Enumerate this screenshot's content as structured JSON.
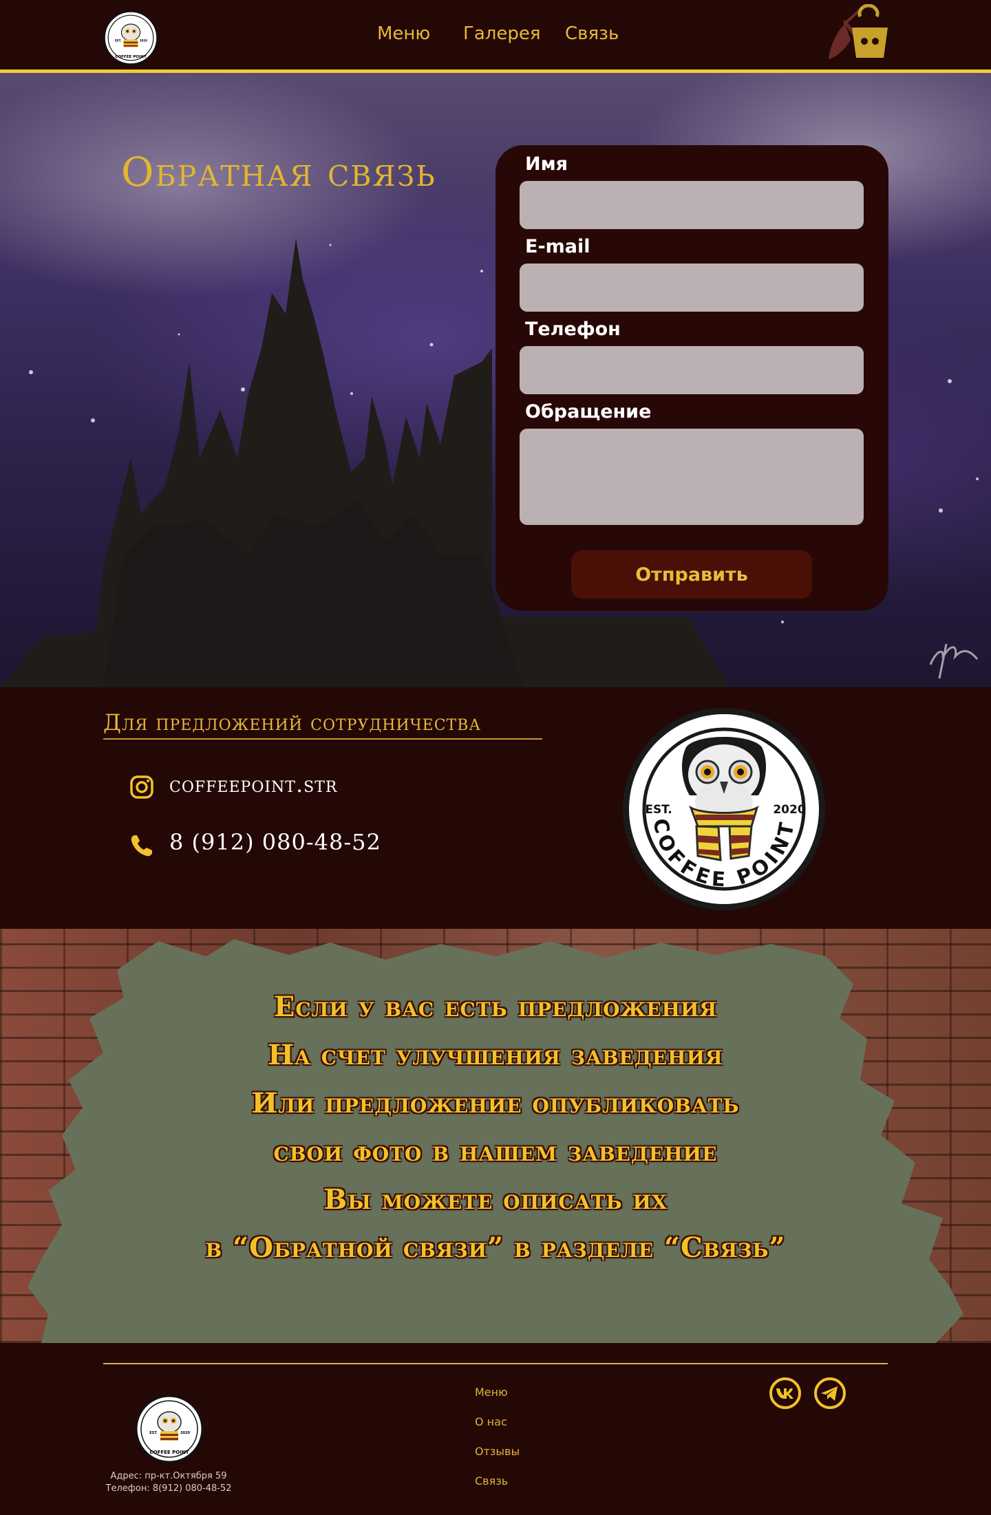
{
  "header": {
    "nav": [
      "Меню",
      "Галерея",
      "Связь"
    ]
  },
  "logo": {
    "est": "EST.",
    "year": "2020",
    "brand": "COFFEE POINT"
  },
  "hero": {
    "title": "Обратная связь",
    "form": {
      "name_label": "Имя",
      "email_label": "E-mail",
      "phone_label": "Телефон",
      "message_label": "Обращение",
      "name_value": "",
      "email_value": "",
      "phone_value": "",
      "message_value": "",
      "submit_label": "Отправить"
    }
  },
  "contact": {
    "title": "Для  предложений сотрудничества",
    "instagram": "coffeepoint.str",
    "phone": "8 (912) 080-48-52"
  },
  "wall": {
    "lines": [
      "Если у вас есть предложения",
      "На счет улучшения заведения",
      "Или предложение опубликовать",
      "свои фото в нашем заведение",
      "Вы можете описать их",
      "в “Обратной связи” в разделе “Связь”"
    ]
  },
  "footer": {
    "address": "Адрес: пр-кт.Октября 59",
    "phone": "Телефон: 8(912) 080-48-52",
    "links": [
      "Меню",
      "О нас",
      "Отзывы",
      "Связь"
    ]
  },
  "colors": {
    "background": "#230806",
    "accent": "#f2cc2e",
    "nav_text": "#e8b93a",
    "input_bg": "#bbb1b3",
    "button_bg": "#4a0f06"
  },
  "icons": [
    "basket-broom-icon",
    "instagram-icon",
    "phone-icon",
    "vk-icon",
    "telegram-icon"
  ]
}
